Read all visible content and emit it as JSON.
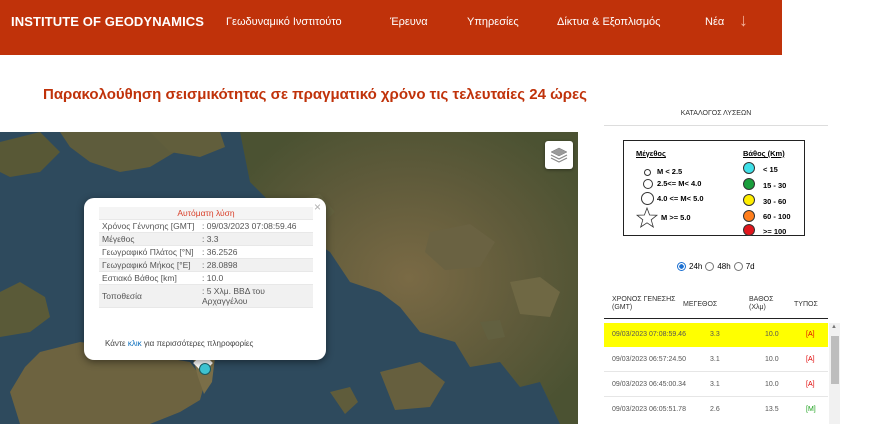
{
  "header": {
    "brand": "INSTITUTE OF GEODYNAMICS",
    "nav": [
      "Γεωδυναμικό Ινστιτούτο",
      "Έρευνα",
      "Υπηρεσίες",
      "Δίκτυα & Εξοπλισμός",
      "Νέα"
    ],
    "arrow_icon": "↓"
  },
  "page_title": "Παρακολούθηση σεισμικότητας σε πραγματικό χρόνο τις τελευταίες 24 ώρες",
  "popup": {
    "title": "Αυτόματη λύση",
    "close": "×",
    "rows": [
      {
        "label": "Χρόνος Γέννησης [GMT]",
        "value": ": 09/03/2023 07:08:59.46"
      },
      {
        "label": "Μέγεθος",
        "value": ": 3.3"
      },
      {
        "label": "Γεωγραφικό Πλάτος [°N]",
        "value": ": 36.2526"
      },
      {
        "label": "Γεωγραφικό Μήκος [°E]",
        "value": ": 28.0898"
      },
      {
        "label": "Εστιακό Βάθος [km]",
        "value": ": 10.0"
      },
      {
        "label": "Τοποθεσία",
        "value": ": 5 Χλμ. ΒΒΔ του Αρχαγγέλου"
      }
    ],
    "more_prefix": "Κάντε ",
    "more_link": "κλικ",
    "more_suffix": " για περισσότερες πληροφορίες"
  },
  "catalog": {
    "title": "ΚΑΤΑΛΟΓΟΣ ΛΥΣΕΩΝ",
    "legend": {
      "magnitude_header": "Μέγεθος",
      "depth_header": "Βάθος (Km)",
      "magnitudes": [
        "M < 2.5",
        "2.5<= M< 4.0",
        "4.0 <= M< 5.0",
        "M >= 5.0"
      ],
      "depths": [
        {
          "label": "< 15",
          "color": "#40e0e8"
        },
        {
          "label": "15 - 30",
          "color": "#1a9e3c"
        },
        {
          "label": "30 - 60",
          "color": "#ffee00"
        },
        {
          "label": "60 - 100",
          "color": "#ff7f1e"
        },
        {
          "label": ">= 100",
          "color": "#e0161c"
        }
      ]
    },
    "range_options": [
      "24h",
      "48h",
      "7d"
    ],
    "selected_range": "24h",
    "columns": [
      "ΧΡΟΝΟΣ ΓΕΝΕΣΗΣ (GMT)",
      "ΜΕΓΕΘΟΣ",
      "ΒΑΘΟΣ (Χλμ)",
      "ΤΥΠΟΣ"
    ],
    "rows": [
      {
        "time": "09/03/2023 07:08:59.46",
        "mag": "3.3",
        "depth": "10.0",
        "type": "[A]",
        "selected": true
      },
      {
        "time": "09/03/2023 06:57:24.50",
        "mag": "3.1",
        "depth": "10.0",
        "type": "[A]",
        "selected": false
      },
      {
        "time": "09/03/2023 06:45:00.34",
        "mag": "3.1",
        "depth": "10.0",
        "type": "[A]",
        "selected": false
      },
      {
        "time": "09/03/2023 06:05:51.78",
        "mag": "2.6",
        "depth": "13.5",
        "type": "[M]",
        "selected": false
      }
    ]
  }
}
